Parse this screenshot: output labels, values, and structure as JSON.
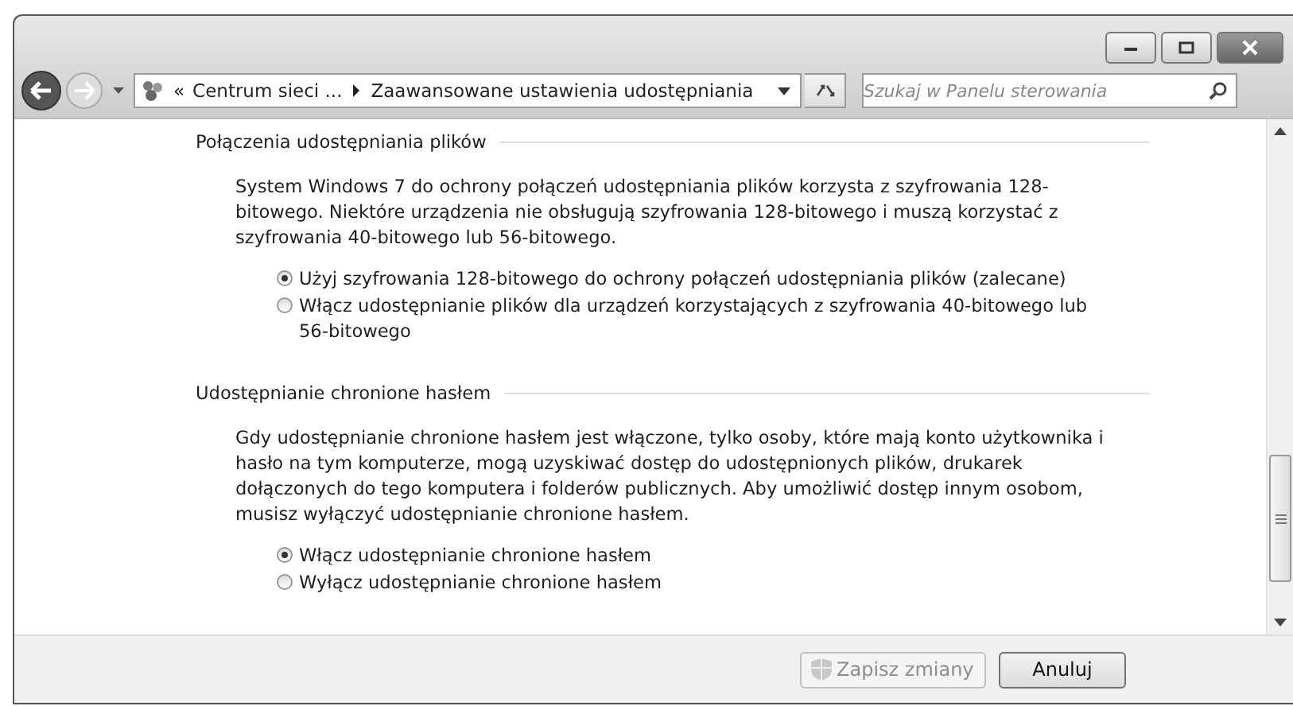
{
  "address_bar": {
    "overflow": "«",
    "breadcrumbs": [
      "Centrum sieci ...",
      "Zaawansowane ustawienia udostępniania"
    ]
  },
  "search": {
    "placeholder": "Szukaj w Panelu sterowania"
  },
  "sections": [
    {
      "heading": "Połączenia udostępniania plików",
      "description": "System Windows 7 do ochrony połączeń udostępniania plików korzysta z szyfrowania 128-bitowego. Niektóre urządzenia nie obsługują szyfrowania 128-bitowego i muszą korzystać z szyfrowania 40-bitowego lub 56-bitowego.",
      "options": [
        {
          "label": "Użyj szyfrowania 128-bitowego do ochrony połączeń udostępniania plików (zalecane)",
          "selected": true
        },
        {
          "label": "Włącz udostępnianie plików dla urządzeń korzystających z szyfrowania 40-bitowego lub 56-bitowego",
          "selected": false
        }
      ]
    },
    {
      "heading": "Udostępnianie chronione hasłem",
      "description": "Gdy udostępnianie chronione hasłem jest włączone, tylko osoby, które mają konto użytkownika i hasło na tym komputerze, mogą uzyskiwać dostęp do udostępnionych plików, drukarek dołączonych do tego komputera i folderów publicznych. Aby umożliwić dostęp innym osobom, musisz wyłączyć udostępnianie chronione hasłem.",
      "options": [
        {
          "label": "Włącz udostępnianie chronione hasłem",
          "selected": true
        },
        {
          "label": "Wyłącz udostępnianie chronione hasłem",
          "selected": false
        }
      ]
    }
  ],
  "buttons": [
    {
      "label": "Zapisz zmiany",
      "kind": "shield",
      "disabled": true
    },
    {
      "label": "Anuluj",
      "kind": "plain",
      "disabled": false
    }
  ]
}
